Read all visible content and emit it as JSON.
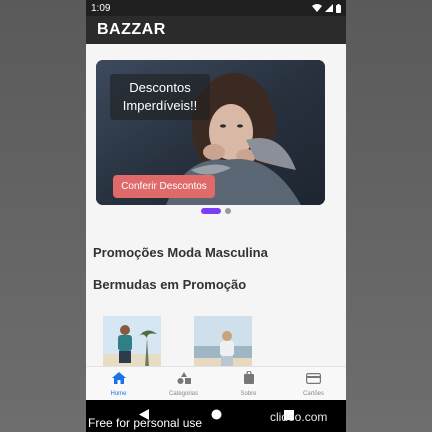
{
  "status_bar": {
    "time": "1:09",
    "icons": [
      "wifi-icon",
      "signal-icon",
      "battery-icon"
    ]
  },
  "app_bar": {
    "title": "BAZZAR"
  },
  "carousel": {
    "promo_text": "Descontos Imperdíveis!!",
    "button_label": "Conferir Descontos",
    "active_index": 0,
    "total": 2
  },
  "sections": [
    {
      "title": "Promoções Moda Masculina"
    },
    {
      "title": "Bermudas em Promoção"
    }
  ],
  "bottom_nav": [
    {
      "label": "Home",
      "icon": "home-icon",
      "active": true
    },
    {
      "label": "Categorias",
      "icon": "categories-icon",
      "active": false
    },
    {
      "label": "Sobre",
      "icon": "bag-icon",
      "active": false
    },
    {
      "label": "Cartões",
      "icon": "card-icon",
      "active": false
    }
  ],
  "watermark": {
    "left": "Free for personal use",
    "right": "clideo.com"
  },
  "colors": {
    "accent": "#7b3ff2",
    "button": "#e06a6a",
    "nav_active": "#1a73e8",
    "app_bar": "#2b2b2b"
  }
}
